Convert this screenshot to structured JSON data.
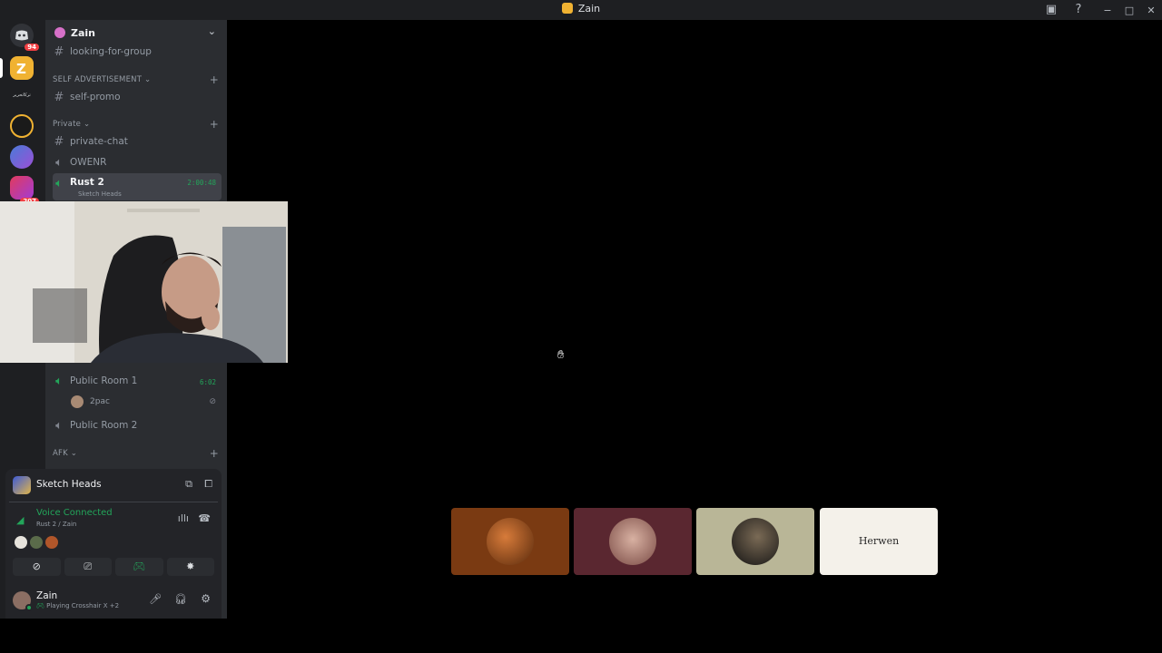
{
  "window": {
    "title": "Zain",
    "minimize": "−",
    "maximize": "□",
    "close": "✕"
  },
  "guilds": {
    "home_badge": "94",
    "badge2": "207",
    "arabic_label": "تركاتحرير"
  },
  "server": {
    "name": "Zain"
  },
  "channels": {
    "looking_for_group": "looking-for-group",
    "cat_self_ad": "SELF ADVERTISEMENT",
    "self_promo": "self-promo",
    "cat_private": "Private",
    "private_chat": "private-chat",
    "owenr": "OWENR",
    "rust2": "Rust 2",
    "rust2_timer": "2:00:48",
    "rust2_activity": "Sketch Heads",
    "public_room_1": "Public Room 1",
    "public_room_1_timer": "6:02",
    "member_2pac": "2pac",
    "public_room_2": "Public Room 2",
    "cat_afk": "AFK"
  },
  "voice_panel": {
    "activity_name": "Sketch Heads",
    "status": "Voice Connected",
    "location": "Rust 2 / Zain"
  },
  "user": {
    "name": "Zain",
    "activity": "Playing Crosshair X",
    "activity_extra": "+2"
  },
  "stage": {
    "tiles": [
      {
        "color": "#7a3a12",
        "label": ""
      },
      {
        "color": "#5a2730",
        "label": ""
      },
      {
        "color": "#b9b697",
        "label": ""
      },
      {
        "color": "#f4f1ea",
        "label": "Herwen"
      }
    ]
  },
  "colors": {
    "accent_green": "#23a55a",
    "bg": "#000000",
    "sidebar": "#2b2d31",
    "rail": "#1e1f22"
  }
}
